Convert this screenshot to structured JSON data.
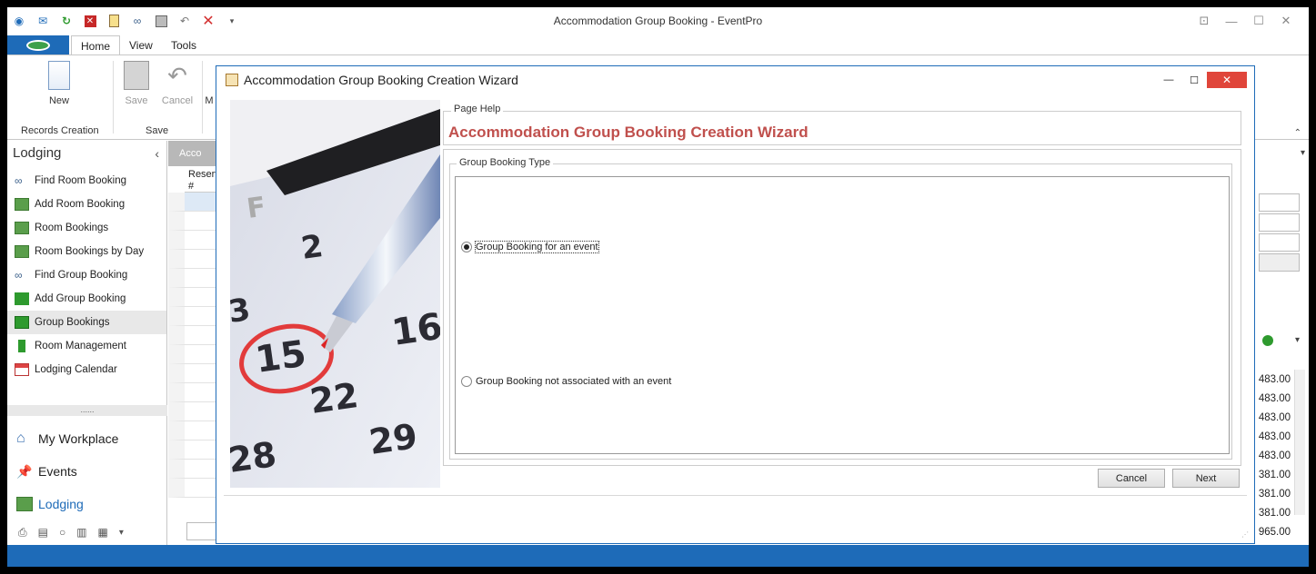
{
  "window": {
    "title": "Accommodation Group Booking - EventPro",
    "controls": [
      "restore",
      "minimize",
      "maximize",
      "close"
    ]
  },
  "quick_access": [
    "refresh-icon",
    "mail-icon",
    "reload-icon",
    "delete-icon",
    "clipboard-icon",
    "binoculars-icon",
    "save-icon",
    "undo-icon",
    "close-icon",
    "customize-icon"
  ],
  "ribbon": {
    "tabs": [
      "Home",
      "View",
      "Tools"
    ],
    "active_tab": "Home",
    "new_label": "New",
    "save_label": "Save",
    "cancel_label": "Cancel",
    "partial_label": "M",
    "group_records": "Records Creation",
    "group_save": "Save"
  },
  "nav": {
    "header": "Lodging",
    "items": [
      {
        "label": "Find Room Booking",
        "icon": "binoculars-icon"
      },
      {
        "label": "Add Room Booking",
        "icon": "add-room-icon"
      },
      {
        "label": "Room Bookings",
        "icon": "room-bookings-icon"
      },
      {
        "label": "Room Bookings by Day",
        "icon": "room-bookings-day-icon"
      },
      {
        "label": "Find Group Booking",
        "icon": "binoculars-icon"
      },
      {
        "label": "Add Group Booking",
        "icon": "add-group-icon"
      },
      {
        "label": "Group Bookings",
        "icon": "group-bookings-icon"
      },
      {
        "label": "Room Management",
        "icon": "room-management-icon"
      },
      {
        "label": "Lodging Calendar",
        "icon": "calendar-icon"
      }
    ],
    "selected": "Group Bookings",
    "dots": "......",
    "workspaces": [
      {
        "label": "My Workplace",
        "icon": "home-icon"
      },
      {
        "label": "Events",
        "icon": "pin-icon"
      },
      {
        "label": "Lodging",
        "icon": "lodging-icon"
      }
    ],
    "active_workspace": "Lodging"
  },
  "grid": {
    "tab_label": "Acco",
    "column_header": "Reserv #"
  },
  "right_values": [
    "483.00",
    "483.00",
    "483.00",
    "483.00",
    "483.00",
    "381.00",
    "381.00",
    "381.00",
    "965.00"
  ],
  "dialog": {
    "title": "Accommodation Group Booking Creation Wizard",
    "page_help_legend": "Page Help",
    "page_help_title": "Accommodation Group Booking Creation Wizard",
    "type_legend": "Group Booking Type",
    "option_event": "Group Booking for an event",
    "option_no_event": "Group Booking not associated with an event",
    "selected_option": "Group Booking for an event",
    "cancel_label": "Cancel",
    "next_label": "Next"
  },
  "colors": {
    "accent": "#1e6bb8",
    "help_title": "#c0504d",
    "close_button": "#e0453a"
  }
}
